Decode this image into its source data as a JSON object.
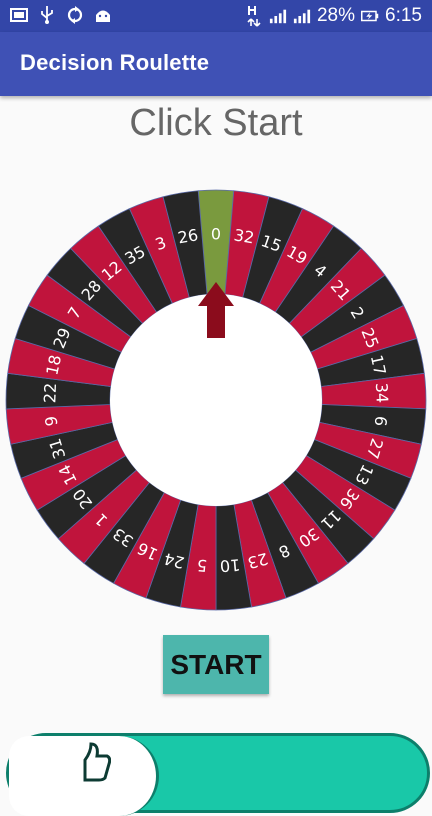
{
  "status_bar": {
    "battery": "28%",
    "time": "6:15",
    "icons": [
      "screen-icon",
      "usb-icon",
      "sync-icon",
      "android-icon",
      "data-h-icon",
      "signal-icon",
      "signal-icon",
      "battery-icon"
    ]
  },
  "app_bar": {
    "title": "Decision Roulette"
  },
  "main": {
    "prompt": "Click Start",
    "start_label": "START"
  },
  "wheel": {
    "numbers": [
      "0",
      "32",
      "15",
      "19",
      "4",
      "21",
      "2",
      "25",
      "17",
      "34",
      "6",
      "27",
      "13",
      "36",
      "11",
      "30",
      "8",
      "23",
      "10",
      "5",
      "24",
      "16",
      "33",
      "1",
      "20",
      "14",
      "31",
      "9",
      "22",
      "18",
      "29",
      "7",
      "28",
      "12",
      "35",
      "3",
      "26"
    ],
    "colors": {
      "red": "#c0143c",
      "black": "#262626",
      "green": "#7a9a3e",
      "pointer": "#8b0c1c",
      "label": "#ffffff",
      "divider": "#5a6aa8"
    }
  }
}
